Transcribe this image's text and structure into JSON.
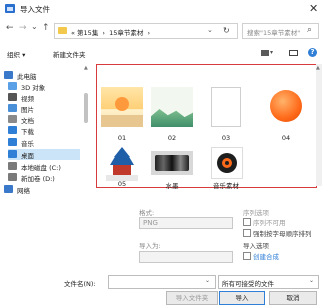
{
  "window": {
    "title": "导入文件",
    "close_glyph": "✕"
  },
  "nav": {
    "back": "←",
    "forward": "→",
    "recent": "⌄",
    "up": "↑",
    "path": [
      "« 第15集",
      "15章节素材"
    ],
    "path_sep": "›",
    "dropdown": "⌄",
    "refresh": "↻",
    "search_placeholder": "搜索\"15章节素材\"",
    "search_icon": "⌕"
  },
  "toolbar": {
    "organize": "组织 ▾",
    "new_folder": "新建文件夹",
    "help": "?"
  },
  "sidebar": {
    "items": [
      {
        "label": "此电脑",
        "icon": "computer-icon",
        "color": "#3a78c9"
      },
      {
        "label": "3D 对象",
        "icon": "3d-objects-icon",
        "color": "#5aa0e6"
      },
      {
        "label": "视频",
        "icon": "video-icon",
        "color": "#555555"
      },
      {
        "label": "图片",
        "icon": "pictures-icon",
        "color": "#4a90d9"
      },
      {
        "label": "文档",
        "icon": "documents-icon",
        "color": "#8a8a8a"
      },
      {
        "label": "下载",
        "icon": "download-icon",
        "color": "#2f7fd6"
      },
      {
        "label": "音乐",
        "icon": "music-icon",
        "color": "#2f7fd6"
      },
      {
        "label": "桌面",
        "icon": "desktop-icon",
        "color": "#2f7fd6"
      },
      {
        "label": "本地磁盘 (C:)",
        "icon": "disk-c-icon",
        "color": "#7a7a7a"
      },
      {
        "label": "新加卷 (D:)",
        "icon": "disk-d-icon",
        "color": "#7a7a7a"
      },
      {
        "label": "网络",
        "icon": "network-icon",
        "color": "#3a78c9"
      }
    ]
  },
  "files": [
    {
      "name": "01",
      "type": "image"
    },
    {
      "name": "02",
      "type": "image"
    },
    {
      "name": "03",
      "type": "blank"
    },
    {
      "name": "04",
      "type": "image"
    },
    {
      "name": "05",
      "type": "image"
    },
    {
      "name": "水墨",
      "type": "image"
    },
    {
      "name": "音乐素材",
      "type": "audio"
    }
  ],
  "options": {
    "format_label": "格式:",
    "format_value": "PNG",
    "import_as_label": "导入为:",
    "sequence_label": "序列选项",
    "sequence_opt1": "序列不可用",
    "sequence_opt2": "强制按字母顺序排列",
    "import_options_label": "导入选项",
    "create_comp": "创建合成"
  },
  "footer": {
    "filename_label": "文件名(N):",
    "filename_value": "",
    "filetype_value": "所有可接受的文件",
    "import_folder": "导入文件夹",
    "import": "导入",
    "cancel": "取消"
  },
  "colors": {
    "accent": "#2f7fd6",
    "highlight_border": "#d83b3b",
    "selected_bg": "#cce4f7"
  }
}
